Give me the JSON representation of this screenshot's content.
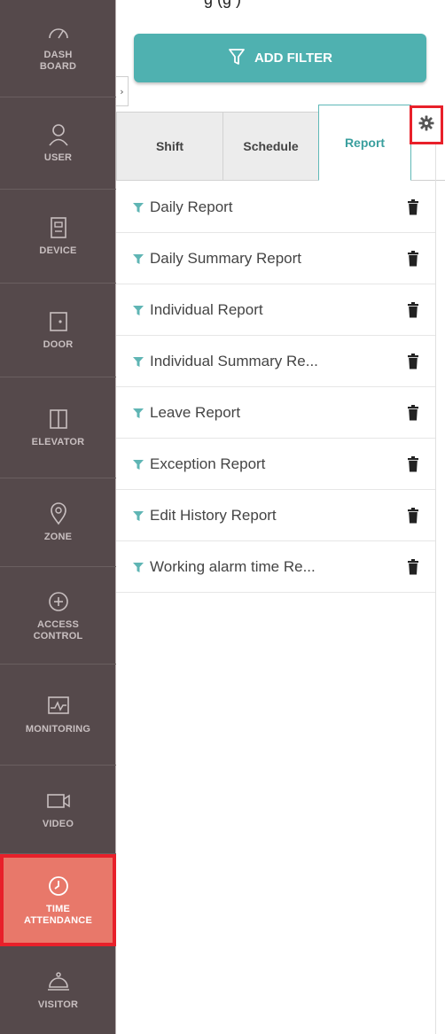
{
  "top_text": "g (g )",
  "sidebar": {
    "items": [
      {
        "label": "DASH\nBOARD",
        "icon": "dashboard-gauge-icon"
      },
      {
        "label": "USER",
        "icon": "user-icon"
      },
      {
        "label": "DEVICE",
        "icon": "device-icon"
      },
      {
        "label": "DOOR",
        "icon": "door-icon"
      },
      {
        "label": "ELEVATOR",
        "icon": "elevator-icon"
      },
      {
        "label": "ZONE",
        "icon": "location-pin-icon"
      },
      {
        "label": "ACCESS\nCONTROL",
        "icon": "plus-circle-icon"
      },
      {
        "label": "MONITORING",
        "icon": "monitoring-icon"
      },
      {
        "label": "VIDEO",
        "icon": "video-camera-icon"
      },
      {
        "label": "TIME\nATTENDANCE",
        "icon": "clock-icon",
        "active": true
      },
      {
        "label": "VISITOR",
        "icon": "visitor-bell-icon"
      }
    ]
  },
  "expander_glyph": "›",
  "add_filter": {
    "label": "ADD FILTER",
    "icon": "funnel-icon"
  },
  "tabs": [
    {
      "label": "Shift"
    },
    {
      "label": "Schedule"
    },
    {
      "label": "Report",
      "active": true
    }
  ],
  "settings_icon": "gear-icon",
  "reports": [
    {
      "label": "Daily Report"
    },
    {
      "label": "Daily Summary Report"
    },
    {
      "label": "Individual Report"
    },
    {
      "label": "Individual Summary Re..."
    },
    {
      "label": "Leave Report"
    },
    {
      "label": "Exception Report"
    },
    {
      "label": "Edit History Report"
    },
    {
      "label": "Working alarm time Re..."
    }
  ],
  "colors": {
    "sidebar_bg": "#55494b",
    "active_nav_bg": "#e8786a",
    "highlight_border": "#e8202a",
    "accent_teal": "#4fb1b0",
    "funnel_teal": "#5fb5b4"
  }
}
